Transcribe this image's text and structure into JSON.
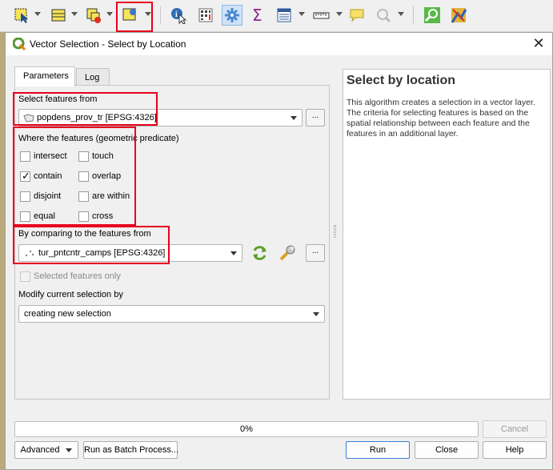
{
  "toolbar": {
    "icons": [
      "select-features-icon",
      "attribute-table-icon",
      "deselect-icon",
      "select-by-location-icon",
      "identify-icon",
      "field-calculator-icon",
      "processing-toolbox-icon",
      "statistics-icon",
      "attributes-icon",
      "measure-icon",
      "map-tips-icon",
      "zoom-icon",
      "browse-icon",
      "plugin-icon"
    ]
  },
  "dialog": {
    "title": "Vector Selection - Select by Location",
    "close_label": "✕"
  },
  "tabs": [
    {
      "label": "Parameters",
      "active": true
    },
    {
      "label": "Log",
      "active": false
    }
  ],
  "params": {
    "select_features_label": "Select features from",
    "select_features_value": "popdens_prov_tr [EPSG:4326]",
    "predicate_label": "Where the features (geometric predicate)",
    "predicates": [
      {
        "label": "intersect",
        "checked": false
      },
      {
        "label": "touch",
        "checked": false
      },
      {
        "label": "contain",
        "checked": true
      },
      {
        "label": "overlap",
        "checked": false
      },
      {
        "label": "disjoint",
        "checked": false
      },
      {
        "label": "are within",
        "checked": false
      },
      {
        "label": "equal",
        "checked": false
      },
      {
        "label": "cross",
        "checked": false
      }
    ],
    "comparing_label": "By comparing to the features from",
    "comparing_value": "tur_pntcntr_camps [EPSG:4326]",
    "selected_only_label": "Selected features only",
    "modify_label": "Modify current selection by",
    "modify_value": "creating new selection",
    "dots": "..."
  },
  "help": {
    "title": "Select by location",
    "body": "This algorithm creates a selection in a vector layer. The criteria for selecting features is based on the spatial relationship between each feature and the features in an additional layer."
  },
  "progress": {
    "text": "0%",
    "fraction": 0
  },
  "buttons": {
    "cancel": "Cancel",
    "advanced": "Advanced",
    "batch": "Run as Batch Process...",
    "run": "Run",
    "close": "Close",
    "help": "Help"
  },
  "colors": {
    "highlight": "#e8001c",
    "accent": "#3c7fd8"
  }
}
